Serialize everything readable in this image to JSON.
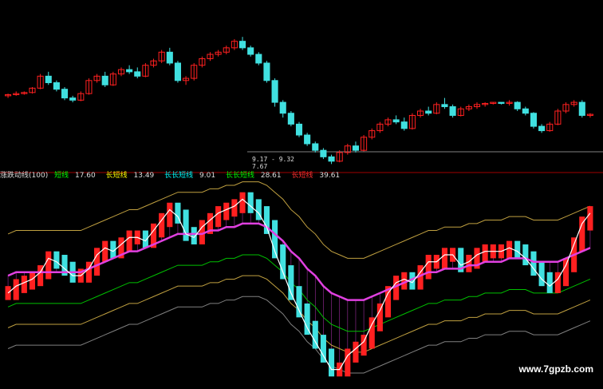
{
  "indicator_header": {
    "name": "涨跌动线(100)",
    "items": [
      {
        "label": "短线",
        "value": "17.60",
        "color": "#00ff00"
      },
      {
        "label": "长短线",
        "value": "13.49",
        "color": "#ffff00"
      },
      {
        "label": "长长短线",
        "value": "9.01",
        "color": "#00ffff"
      },
      {
        "label": "长长短线",
        "value": "28.61",
        "color": "#00ff00"
      },
      {
        "label": "长短线",
        "value": "39.61",
        "color": "#ff3030"
      }
    ]
  },
  "price_labels": {
    "range": "9.17 - 9.32",
    "low": "7.67"
  },
  "watermark": "www.7gpzb.com",
  "colors": {
    "background": "#000000",
    "up": "#ff2020",
    "down": "#40e0e0",
    "magenta": "#e040e0",
    "white_line": "#ffffff",
    "green_line": "#00c000",
    "yellow_line": "#c0a040",
    "gray_line": "#808080",
    "sep_red": "#a00000"
  },
  "chart_data": [
    {
      "type": "candlestick",
      "title": "",
      "candles": [
        [
          10.8,
          10.9,
          10.7,
          10.85
        ],
        [
          10.85,
          11.0,
          10.8,
          10.9
        ],
        [
          10.9,
          11.0,
          10.85,
          10.95
        ],
        [
          10.95,
          11.2,
          10.9,
          11.15
        ],
        [
          11.15,
          11.8,
          11.1,
          11.7
        ],
        [
          11.7,
          11.9,
          11.3,
          11.4
        ],
        [
          11.4,
          11.5,
          11.0,
          11.1
        ],
        [
          11.1,
          11.2,
          10.6,
          10.7
        ],
        [
          10.7,
          10.8,
          10.5,
          10.6
        ],
        [
          10.6,
          11.0,
          10.55,
          10.9
        ],
        [
          10.9,
          11.6,
          10.85,
          11.5
        ],
        [
          11.5,
          11.8,
          11.4,
          11.7
        ],
        [
          11.7,
          11.9,
          11.2,
          11.3
        ],
        [
          11.3,
          11.9,
          11.25,
          11.8
        ],
        [
          11.8,
          12.1,
          11.7,
          12.0
        ],
        [
          12.0,
          12.2,
          11.8,
          11.9
        ],
        [
          11.9,
          12.1,
          11.6,
          11.7
        ],
        [
          11.7,
          12.3,
          11.65,
          12.2
        ],
        [
          12.2,
          12.5,
          12.1,
          12.4
        ],
        [
          12.4,
          12.9,
          12.3,
          12.8
        ],
        [
          12.8,
          13.0,
          12.2,
          12.3
        ],
        [
          12.3,
          12.4,
          11.4,
          11.5
        ],
        [
          11.5,
          11.7,
          11.3,
          11.6
        ],
        [
          11.6,
          12.3,
          11.5,
          12.2
        ],
        [
          12.2,
          12.6,
          12.1,
          12.5
        ],
        [
          12.5,
          12.8,
          12.4,
          12.7
        ],
        [
          12.7,
          12.9,
          12.6,
          12.8
        ],
        [
          12.8,
          13.1,
          12.7,
          13.0
        ],
        [
          13.0,
          13.4,
          12.9,
          13.3
        ],
        [
          13.3,
          13.5,
          12.9,
          13.0
        ],
        [
          13.0,
          13.1,
          12.6,
          12.7
        ],
        [
          12.7,
          12.8,
          12.2,
          12.3
        ],
        [
          12.3,
          12.4,
          11.4,
          11.5
        ],
        [
          11.5,
          11.6,
          10.3,
          10.5
        ],
        [
          10.5,
          10.6,
          9.8,
          10.0
        ],
        [
          10.0,
          10.1,
          9.4,
          9.5
        ],
        [
          9.5,
          9.6,
          8.9,
          9.0
        ],
        [
          9.0,
          9.1,
          8.5,
          8.6
        ],
        [
          8.6,
          8.7,
          8.2,
          8.3
        ],
        [
          8.3,
          8.4,
          7.9,
          8.0
        ],
        [
          8.0,
          8.1,
          7.67,
          7.8
        ],
        [
          7.8,
          8.3,
          7.75,
          8.2
        ],
        [
          8.2,
          8.6,
          8.1,
          8.5
        ],
        [
          8.5,
          8.7,
          8.2,
          8.3
        ],
        [
          8.3,
          9.0,
          8.25,
          8.9
        ],
        [
          8.9,
          9.3,
          8.8,
          9.2
        ],
        [
          9.2,
          9.6,
          9.1,
          9.5
        ],
        [
          9.5,
          9.8,
          9.4,
          9.7
        ],
        [
          9.7,
          9.9,
          9.5,
          9.6
        ],
        [
          9.6,
          9.8,
          9.2,
          9.3
        ],
        [
          9.3,
          10.0,
          9.25,
          9.9
        ],
        [
          9.9,
          10.2,
          9.8,
          10.1
        ],
        [
          10.1,
          10.3,
          9.9,
          10.0
        ],
        [
          10.0,
          10.5,
          9.95,
          10.4
        ],
        [
          10.4,
          10.7,
          10.2,
          10.3
        ],
        [
          10.3,
          10.4,
          9.8,
          9.9
        ],
        [
          9.9,
          10.3,
          9.85,
          10.2
        ],
        [
          10.2,
          10.4,
          10.1,
          10.3
        ],
        [
          10.3,
          10.5,
          10.2,
          10.4
        ],
        [
          10.4,
          10.5,
          10.3,
          10.45
        ],
        [
          10.45,
          10.5,
          10.4,
          10.5
        ],
        [
          10.5,
          10.5,
          10.4,
          10.45
        ],
        [
          10.45,
          10.6,
          10.35,
          10.5
        ],
        [
          10.5,
          10.55,
          10.1,
          10.2
        ],
        [
          10.2,
          10.3,
          9.9,
          10.0
        ],
        [
          10.0,
          10.05,
          9.3,
          9.4
        ],
        [
          9.4,
          9.5,
          9.1,
          9.2
        ],
        [
          9.2,
          9.6,
          9.15,
          9.5
        ],
        [
          9.5,
          10.2,
          9.45,
          10.1
        ],
        [
          10.1,
          10.5,
          10.0,
          10.4
        ],
        [
          10.4,
          10.6,
          10.3,
          10.5
        ],
        [
          10.5,
          10.6,
          9.8,
          9.9
        ],
        [
          9.9,
          10.0,
          9.8,
          9.95
        ]
      ]
    },
    {
      "type": "indicator",
      "series": [
        {
          "values": [
            6.4,
            6.6,
            6.7,
            6.8,
            7.0,
            7.4,
            7.3,
            7.1,
            6.9,
            6.9,
            7.1,
            7.5,
            7.7,
            7.6,
            7.8,
            8.0,
            8.0,
            7.9,
            8.2,
            8.5,
            8.8,
            8.6,
            8.1,
            8.0,
            8.3,
            8.5,
            8.7,
            8.8,
            8.9,
            9.1,
            8.9,
            8.7,
            8.3,
            7.6,
            7.0,
            6.4,
            5.9,
            5.4,
            5.0,
            4.6,
            4.2,
            4.2,
            4.6,
            4.8,
            5.0,
            5.5,
            5.9,
            6.4,
            6.7,
            6.8,
            6.7,
            7.0,
            7.3,
            7.3,
            7.5,
            7.5,
            7.2,
            7.3,
            7.5,
            7.6,
            7.6,
            7.6,
            7.7,
            7.6,
            7.4,
            7.1,
            6.8,
            6.6,
            6.8,
            7.2,
            7.8,
            8.4,
            8.7
          ]
        },
        {
          "values": [
            6.9,
            7.0,
            7.0,
            7.0,
            7.0,
            7.0,
            7.0,
            7.0,
            7.0,
            7.0,
            7.1,
            7.2,
            7.3,
            7.4,
            7.5,
            7.6,
            7.6,
            7.7,
            7.8,
            7.9,
            8.0,
            8.1,
            8.1,
            8.1,
            8.1,
            8.2,
            8.2,
            8.3,
            8.3,
            8.4,
            8.4,
            8.4,
            8.3,
            8.1,
            7.9,
            7.6,
            7.4,
            7.1,
            6.9,
            6.6,
            6.4,
            6.3,
            6.2,
            6.2,
            6.2,
            6.3,
            6.4,
            6.5,
            6.6,
            6.7,
            6.8,
            6.9,
            7.0,
            7.0,
            7.1,
            7.1,
            7.1,
            7.2,
            7.2,
            7.3,
            7.3,
            7.3,
            7.4,
            7.4,
            7.4,
            7.3,
            7.3,
            7.3,
            7.3,
            7.4,
            7.5,
            7.6,
            7.7
          ]
        }
      ]
    }
  ]
}
